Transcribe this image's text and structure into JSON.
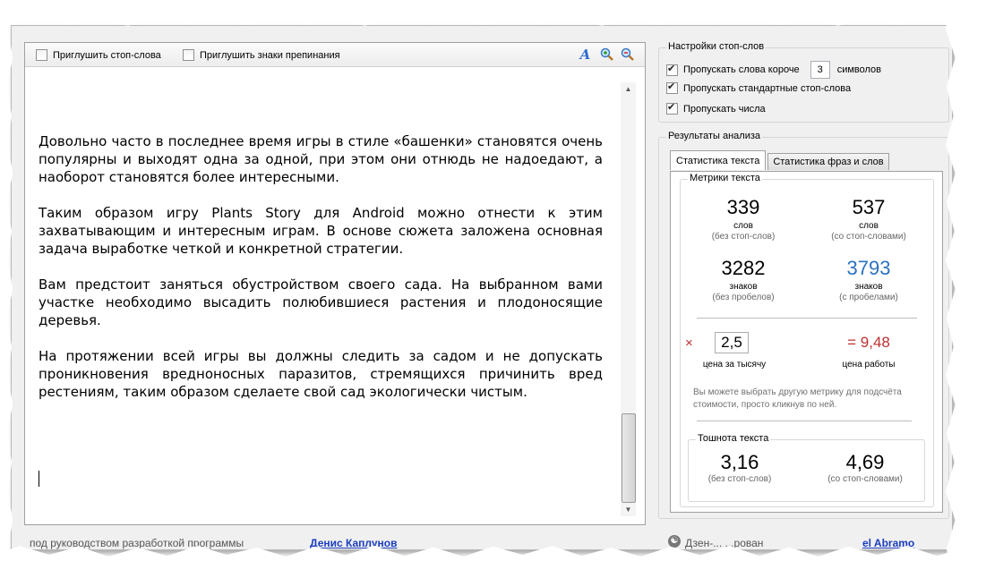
{
  "editor": {
    "toolbar": {
      "mute_stopwords_label": "Приглушить стоп-слова",
      "mute_punctuation_label": "Приглушить знаки препинания",
      "font_icon": "font-A-icon",
      "zoom_in_icon": "zoom-in-icon",
      "zoom_out_icon": "zoom-out-icon"
    },
    "paragraphs": [
      "Довольно часто в последнее время игры в стиле «башенки» становятся очень популярны и выходят одна за одной, при этом они отнюдь не надоедают, а наоборот становятся более интересными.",
      " Таким образом игру Plants Story для Android можно отнести к этим захватывающим и интересным играм. В основе сюжета заложена основная задача выработке четкой и конкретной стратегии.",
      " Вам предстоит заняться обустройством своего сада. На выбранном вами участке необходимо высадить полюбившиеся растения и плодоносящие деревья.",
      " На протяжении всей игры вы должны следить за садом и не допускать проникновения вредноносных паразитов, стремящихся причинить вред рестениям, таким образом сделаете свой сад экологически чистым."
    ]
  },
  "stop_settings": {
    "title": "Настройки стоп-слов",
    "skip_short_label": "Пропускать слова короче",
    "skip_short_value": "3",
    "skip_short_suffix": "символов",
    "skip_standard_label": "Пропускать стандартные стоп-слова",
    "skip_numbers_label": "Пропускать числа"
  },
  "analysis": {
    "title": "Результаты анализа",
    "tabs": [
      "Статистика текста",
      "Статистика фраз и слов"
    ],
    "metrics_title": "Метрики текста",
    "words_no_stop": {
      "value": "339",
      "label": "слов",
      "sub": "(без стоп-слов)"
    },
    "words_with_stop": {
      "value": "537",
      "label": "слов",
      "sub": "(со стоп-словами)"
    },
    "chars_no_spaces": {
      "value": "3282",
      "label": "знаков",
      "sub": "(без пробелов)"
    },
    "chars_with_spaces": {
      "value": "3793",
      "label": "знаков",
      "sub": "(с пробелами)"
    },
    "multiply_sign": "×",
    "price_per_thousand": {
      "value": "2,5",
      "label": "цена за тысячу"
    },
    "work_price": {
      "value": "= 9,48",
      "label": "цена работы"
    },
    "note": "Вы можете выбрать другую метрику для подсчёта стоимости, просто кликнув по ней.",
    "nausea_title": "Тошнота текста",
    "nausea_no_stop": {
      "value": "3,16",
      "sub": "(без стоп-слов)"
    },
    "nausea_with_stop": {
      "value": "4,69",
      "sub": "(со стоп-словами)"
    }
  },
  "status": {
    "left_text": "под руководством разработкой программы",
    "left_link": "Денис Каплунов",
    "right_text": "Дзен-... ...рован",
    "right_link": "el Abramo"
  },
  "colors": {
    "accent_blue": "#2b72c2",
    "price_red": "#c03030",
    "link_blue": "#1a3dbf"
  }
}
